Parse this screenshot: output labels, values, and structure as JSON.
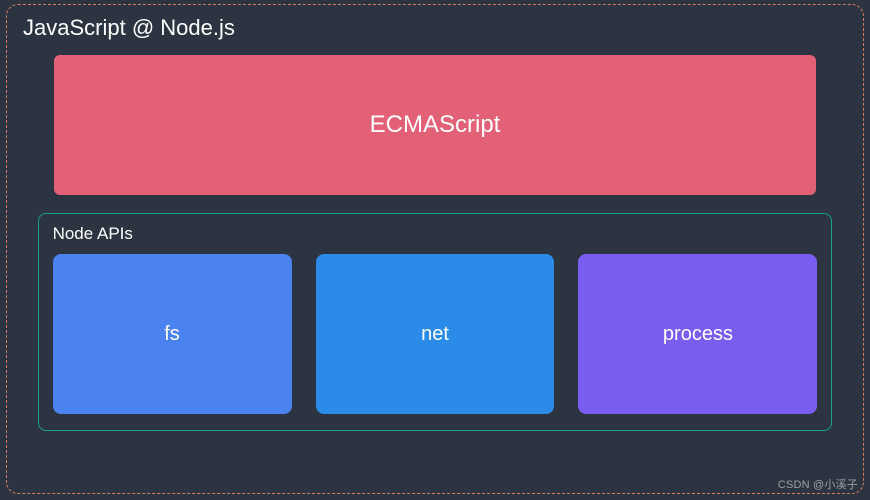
{
  "title": "JavaScript @ Node.js",
  "ecma_label": "ECMAScript",
  "node_apis": {
    "title": "Node APIs",
    "items": [
      {
        "label": "fs"
      },
      {
        "label": "net"
      },
      {
        "label": "process"
      }
    ]
  },
  "watermark": "CSDN @小溪子",
  "colors": {
    "background": "#2b3440",
    "outer_border": "#d67b5c",
    "ecma_bg": "#e36176",
    "node_apis_border": "#17a085",
    "api_fs": "#4a83f0",
    "api_net": "#2a8ce8",
    "api_process": "#7a5cf0"
  }
}
